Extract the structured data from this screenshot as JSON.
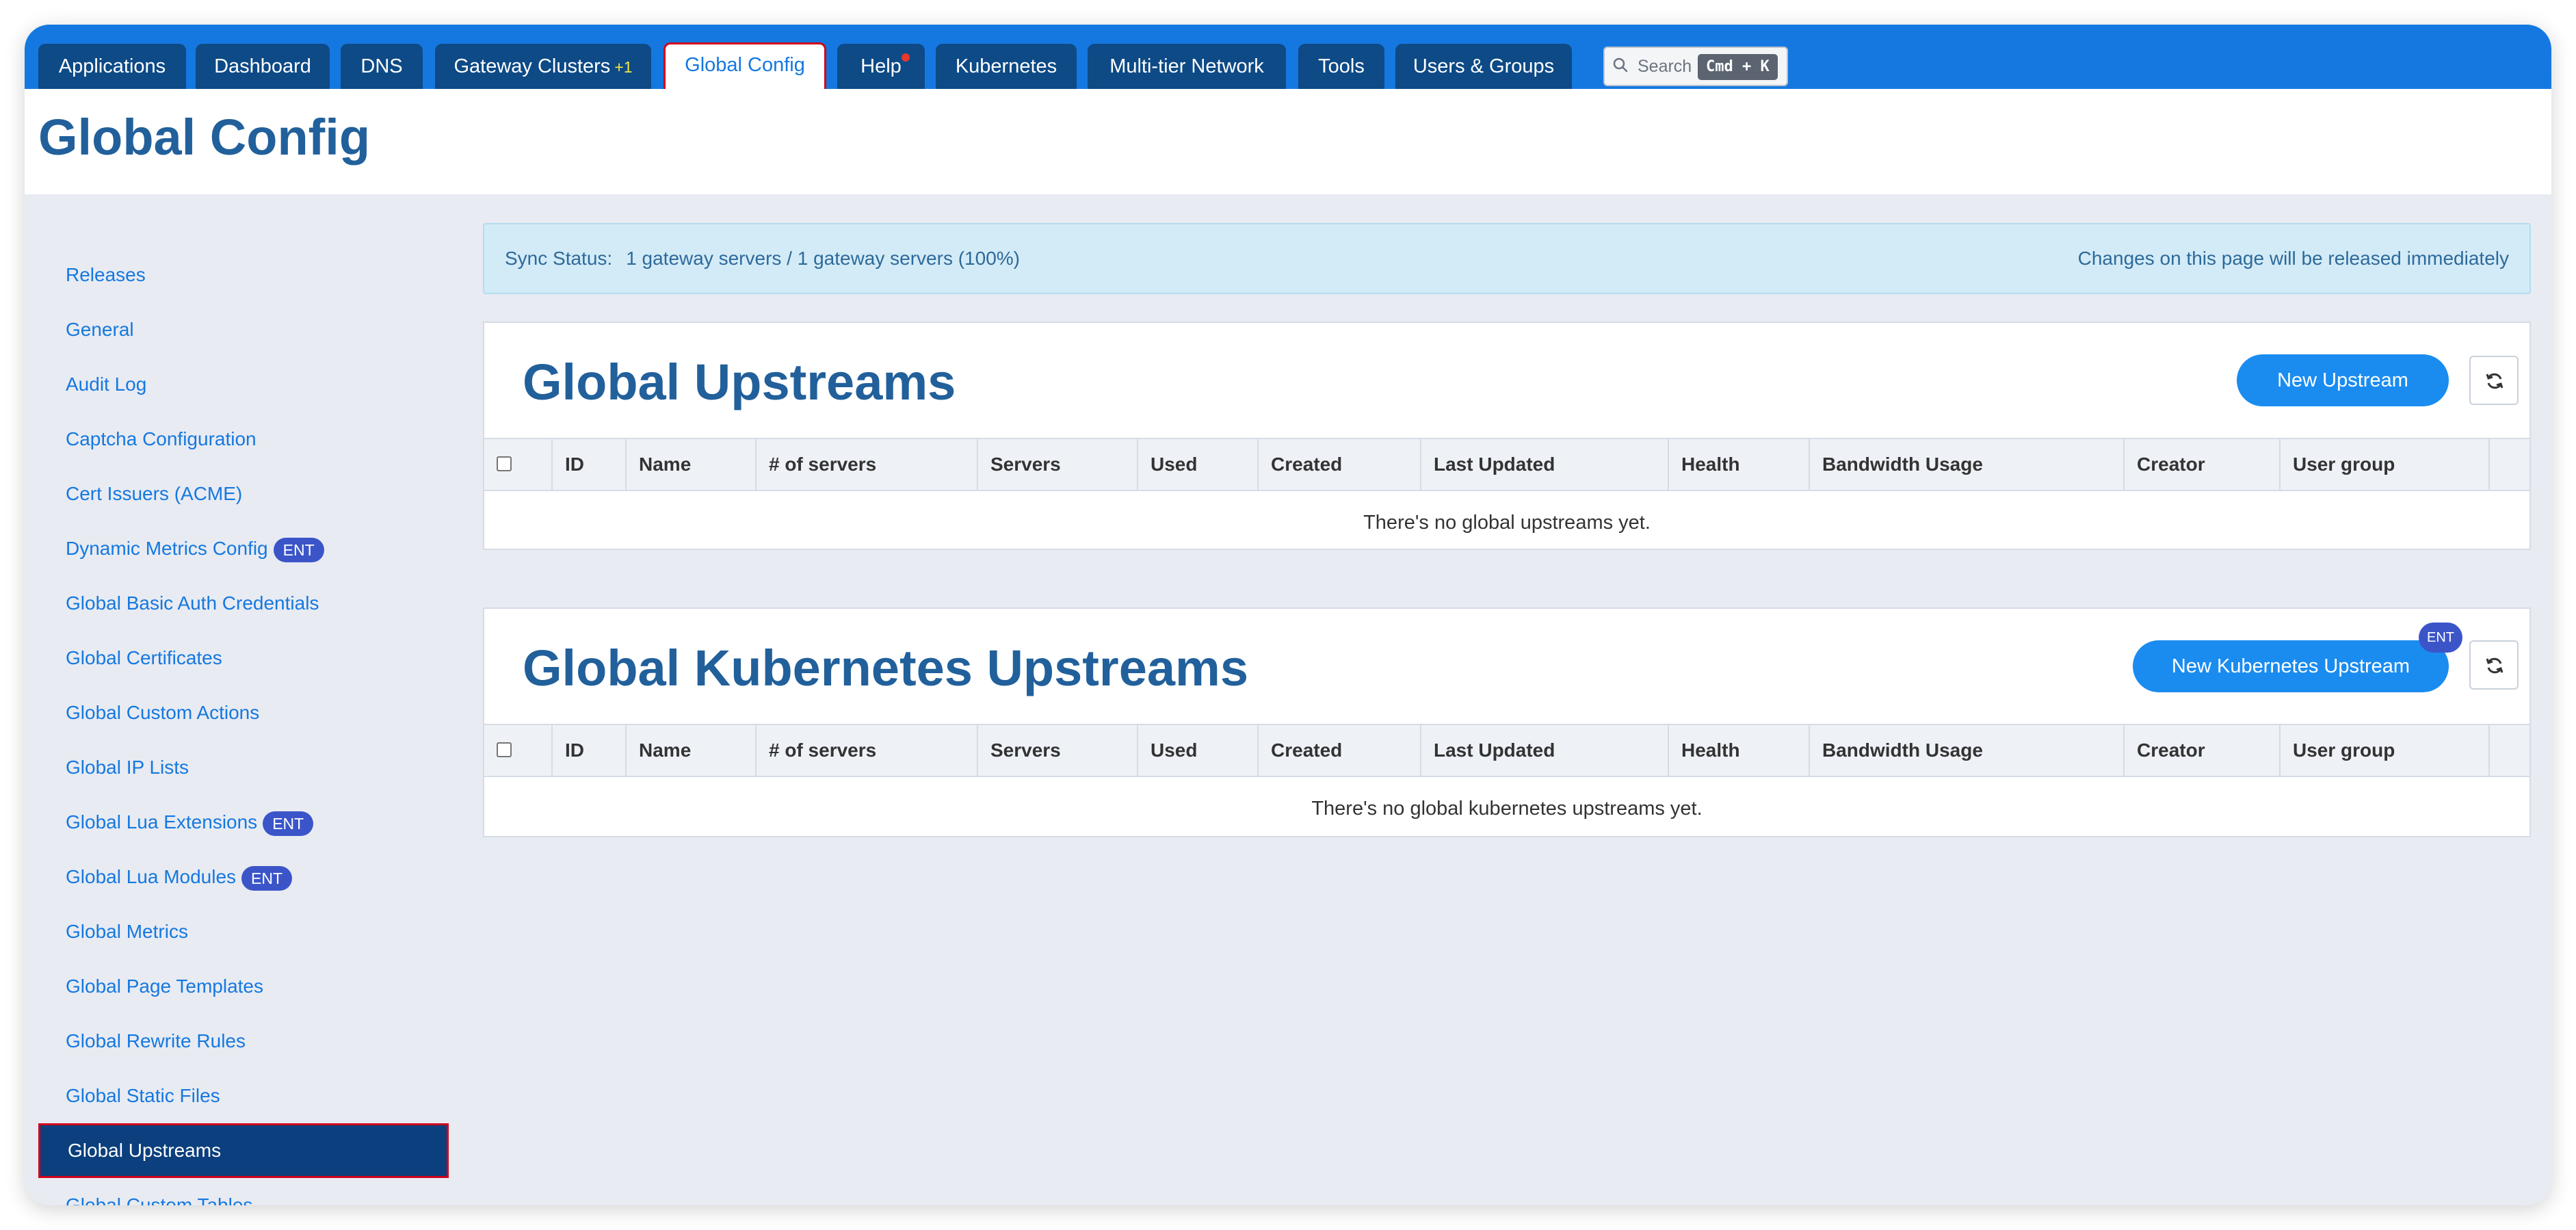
{
  "nav": {
    "tabs": [
      {
        "label": "Applications"
      },
      {
        "label": "Dashboard"
      },
      {
        "label": "DNS"
      },
      {
        "label": "Gateway Clusters",
        "count": "+1"
      },
      {
        "label": "Global Config"
      },
      {
        "label": "Help"
      },
      {
        "label": "Kubernetes"
      },
      {
        "label": "Multi-tier Network"
      },
      {
        "label": "Tools"
      },
      {
        "label": "Users & Groups"
      }
    ],
    "search": {
      "label": "Search",
      "shortcut": "Cmd + K"
    }
  },
  "page": {
    "title": "Global Config"
  },
  "sidebar": {
    "items": [
      {
        "label": "Releases"
      },
      {
        "label": "General"
      },
      {
        "label": "Audit Log"
      },
      {
        "label": "Captcha Configuration"
      },
      {
        "label": "Cert Issuers (ACME)"
      },
      {
        "label": "Dynamic Metrics Config",
        "badge": "ENT"
      },
      {
        "label": "Global Basic Auth Credentials"
      },
      {
        "label": "Global Certificates"
      },
      {
        "label": "Global Custom Actions"
      },
      {
        "label": "Global IP Lists"
      },
      {
        "label": "Global Lua Extensions",
        "badge": "ENT"
      },
      {
        "label": "Global Lua Modules",
        "badge": "ENT"
      },
      {
        "label": "Global Metrics"
      },
      {
        "label": "Global Page Templates"
      },
      {
        "label": "Global Rewrite Rules"
      },
      {
        "label": "Global Static Files"
      },
      {
        "label": "Global Upstreams"
      },
      {
        "label": "Global Custom Tables"
      }
    ]
  },
  "sync": {
    "label": "Sync Status:",
    "value": "1 gateway servers / 1 gateway servers (100%)",
    "note": "Changes on this page will be released immediately"
  },
  "upstreams": {
    "title": "Global Upstreams",
    "new_button": "New Upstream",
    "empty": "There's no global upstreams yet."
  },
  "k8s": {
    "title": "Global Kubernetes Upstreams",
    "new_button": "New Kubernetes Upstream",
    "badge": "ENT",
    "empty": "There's no global kubernetes upstreams yet."
  },
  "table": {
    "columns": [
      "ID",
      "Name",
      "# of servers",
      "Servers",
      "Used",
      "Created",
      "Last Updated",
      "Health",
      "Bandwidth Usage",
      "Creator",
      "User group"
    ]
  },
  "colors": {
    "accent": "#1578e0",
    "nav_tab": "#0d4a86",
    "active_side": "#0b3f7d",
    "ent": "#3b55c9",
    "highlight": "#d0021b"
  }
}
